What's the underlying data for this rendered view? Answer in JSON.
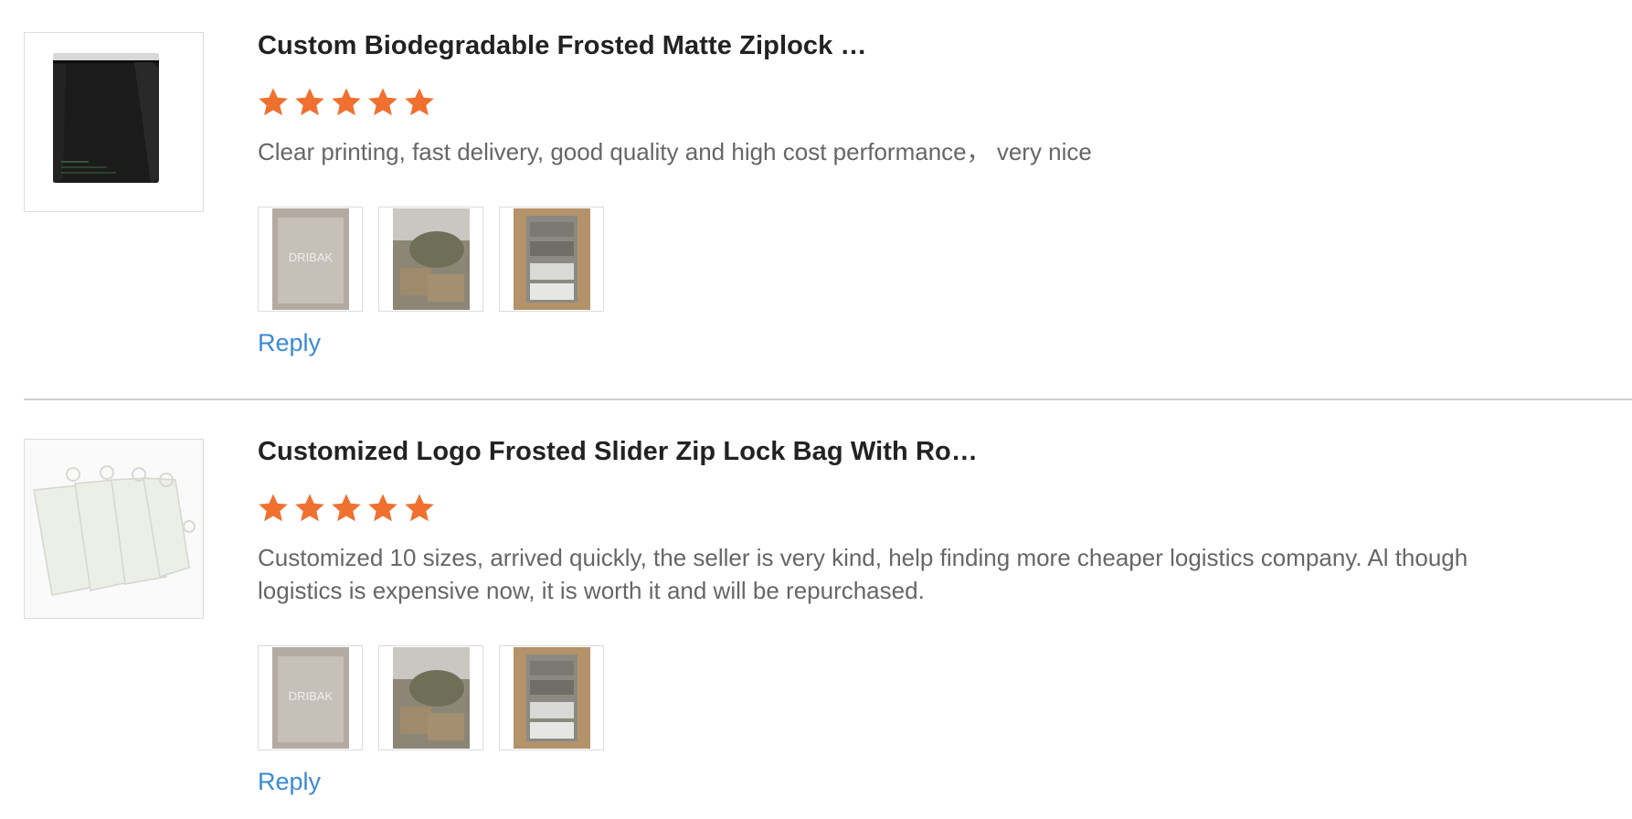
{
  "colors": {
    "star": "#f07030",
    "link": "#3a8ad6",
    "divider": "#cfcfcf"
  },
  "reviews": [
    {
      "product_title": "Custom Biodegradable Frosted Matte Ziplock …",
      "rating": 5,
      "rating_max": 5,
      "text": "Clear printing, fast delivery, good quality and high cost performance，  very nice",
      "reply_label": "Reply",
      "product_image": "black-zip-bag",
      "photos": [
        "frosted-bag-photo",
        "parcels-photo",
        "boxed-bags-photo"
      ]
    },
    {
      "product_title": "Customized Logo Frosted Slider Zip Lock Bag With Ro…",
      "rating": 5,
      "rating_max": 5,
      "text": "Customized 10 sizes, arrived quickly, the seller is very kind, help finding more cheaper logistics company. Al though logistics is expensive now, it is worth it and will be repurchased.",
      "reply_label": "Reply",
      "product_image": "white-frosted-bags",
      "photos": [
        "frosted-bag-photo",
        "parcels-photo",
        "boxed-bags-photo"
      ]
    }
  ]
}
